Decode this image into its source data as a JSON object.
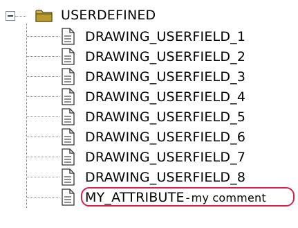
{
  "tree": {
    "root": {
      "label": "USERDEFINED",
      "icon": "folder-icon",
      "toggle": "minus-icon"
    },
    "items": [
      {
        "label": "DRAWING_USERFIELD_1",
        "icon": "document-icon"
      },
      {
        "label": "DRAWING_USERFIELD_2",
        "icon": "document-icon"
      },
      {
        "label": "DRAWING_USERFIELD_3",
        "icon": "document-icon"
      },
      {
        "label": "DRAWING_USERFIELD_4",
        "icon": "document-icon"
      },
      {
        "label": "DRAWING_USERFIELD_5",
        "icon": "document-icon"
      },
      {
        "label": "DRAWING_USERFIELD_6",
        "icon": "document-icon"
      },
      {
        "label": "DRAWING_USERFIELD_7",
        "icon": "document-icon"
      },
      {
        "label": "DRAWING_USERFIELD_8",
        "icon": "document-icon"
      }
    ],
    "highlighted_item": {
      "label": "MY_ATTRIBUTE",
      "separator": "-",
      "comment": "my comment",
      "icon": "document-icon",
      "highlight_color": "#d8204a"
    }
  }
}
